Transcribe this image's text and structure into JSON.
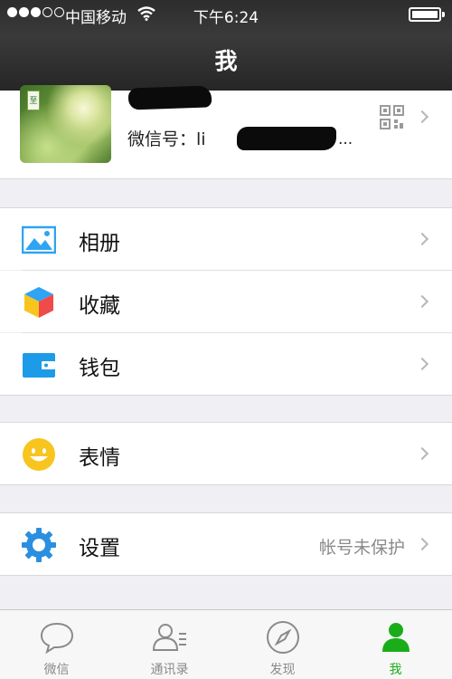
{
  "status_bar": {
    "carrier": "中国移动",
    "time": "下午6:24",
    "signal_bars_filled": 3,
    "signal_bars_total": 5
  },
  "nav": {
    "title": "我"
  },
  "profile": {
    "wechat_id_label": "微信号：li",
    "wechat_id_tail": "...",
    "qr_icon": "qr-code-icon"
  },
  "menu": {
    "album": {
      "label": "相册",
      "icon": "photo-icon"
    },
    "favorites": {
      "label": "收藏",
      "icon": "cube-icon"
    },
    "wallet": {
      "label": "钱包",
      "icon": "wallet-icon"
    },
    "stickers": {
      "label": "表情",
      "icon": "smiley-icon"
    },
    "settings": {
      "label": "设置",
      "icon": "gear-icon",
      "value": "帐号未保护"
    }
  },
  "tabbar": {
    "tabs": [
      {
        "label": "微信",
        "icon": "chat-bubble-icon"
      },
      {
        "label": "通讯录",
        "icon": "contacts-icon"
      },
      {
        "label": "发现",
        "icon": "compass-icon"
      },
      {
        "label": "我",
        "icon": "person-icon",
        "active": true
      }
    ]
  },
  "colors": {
    "accent": "#1aad19",
    "header": "#2d2d2d",
    "background": "#efeff4",
    "album_blue": "#2ea4f2",
    "wallet_blue": "#1e9be8",
    "smiley_yellow": "#f7c51e",
    "gear_blue": "#2a8fe0"
  }
}
